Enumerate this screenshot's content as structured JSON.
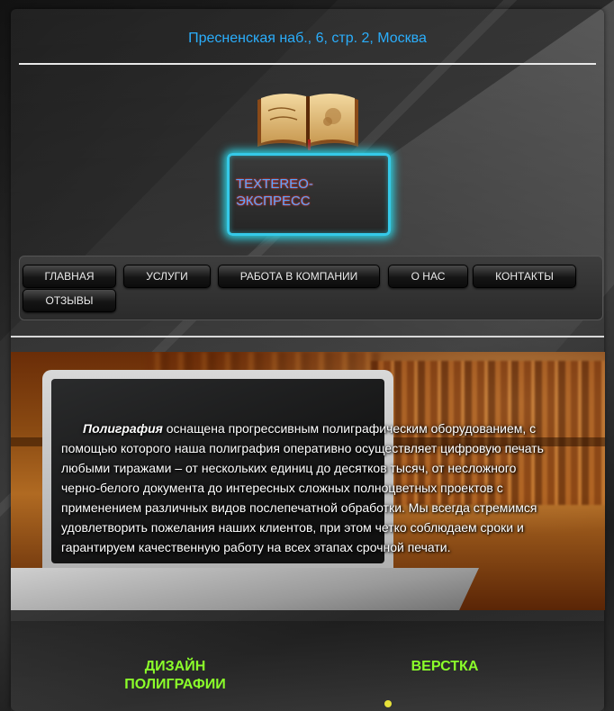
{
  "header": {
    "address": "Пресненская наб., 6, стр. 2, Москва"
  },
  "logo": {
    "book_alt": "book-logo",
    "name_line1": "TEXTEREO-",
    "name_line2": "ЭКСПРЕСС"
  },
  "nav": {
    "items": [
      {
        "label": "ГЛАВНАЯ"
      },
      {
        "label": "УСЛУГИ"
      },
      {
        "label": "РАБОТА В КОМПАНИИ"
      },
      {
        "label": "О НАС"
      },
      {
        "label": "КОНТАКТЫ"
      },
      {
        "label": "ОТЗЫВЫ"
      }
    ]
  },
  "hero": {
    "lead_bold": "Полиграфия",
    "text": " оснащена прогрессивным полиграфическим оборудованием, с помощью которого наша полиграфия оперативно осуществляет цифровую печать любыми тиражами – от нескольких единиц до десятков тысяч, от несложного черно-белого документа до интересных сложных полноцветных проектов с применением различных видов послепечатной обработки. Мы всегда стремимся удовлетворить пожелания наших клиентов, при этом четко соблюдаем сроки и гарантируем качественную работу на всех этапах срочной печати."
  },
  "services": {
    "items": [
      {
        "title_line1": "ДИЗАЙН",
        "title_line2": "ПОЛИГРАФИИ"
      },
      {
        "title_line1": "ВЕРСТКА"
      }
    ]
  },
  "colors": {
    "address": "#2aaefc",
    "logo_glow": "#2cd7e8",
    "service_title": "#8bff2a"
  }
}
